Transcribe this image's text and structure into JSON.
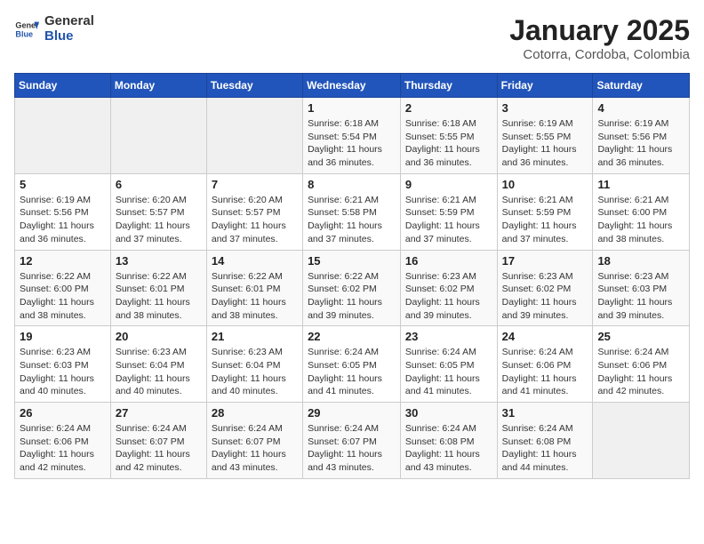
{
  "header": {
    "logo_general": "General",
    "logo_blue": "Blue",
    "title": "January 2025",
    "location": "Cotorra, Cordoba, Colombia"
  },
  "weekdays": [
    "Sunday",
    "Monday",
    "Tuesday",
    "Wednesday",
    "Thursday",
    "Friday",
    "Saturday"
  ],
  "weeks": [
    [
      {
        "day": "",
        "info": ""
      },
      {
        "day": "",
        "info": ""
      },
      {
        "day": "",
        "info": ""
      },
      {
        "day": "1",
        "info": "Sunrise: 6:18 AM\nSunset: 5:54 PM\nDaylight: 11 hours and 36 minutes."
      },
      {
        "day": "2",
        "info": "Sunrise: 6:18 AM\nSunset: 5:55 PM\nDaylight: 11 hours and 36 minutes."
      },
      {
        "day": "3",
        "info": "Sunrise: 6:19 AM\nSunset: 5:55 PM\nDaylight: 11 hours and 36 minutes."
      },
      {
        "day": "4",
        "info": "Sunrise: 6:19 AM\nSunset: 5:56 PM\nDaylight: 11 hours and 36 minutes."
      }
    ],
    [
      {
        "day": "5",
        "info": "Sunrise: 6:19 AM\nSunset: 5:56 PM\nDaylight: 11 hours and 36 minutes."
      },
      {
        "day": "6",
        "info": "Sunrise: 6:20 AM\nSunset: 5:57 PM\nDaylight: 11 hours and 37 minutes."
      },
      {
        "day": "7",
        "info": "Sunrise: 6:20 AM\nSunset: 5:57 PM\nDaylight: 11 hours and 37 minutes."
      },
      {
        "day": "8",
        "info": "Sunrise: 6:21 AM\nSunset: 5:58 PM\nDaylight: 11 hours and 37 minutes."
      },
      {
        "day": "9",
        "info": "Sunrise: 6:21 AM\nSunset: 5:59 PM\nDaylight: 11 hours and 37 minutes."
      },
      {
        "day": "10",
        "info": "Sunrise: 6:21 AM\nSunset: 5:59 PM\nDaylight: 11 hours and 37 minutes."
      },
      {
        "day": "11",
        "info": "Sunrise: 6:21 AM\nSunset: 6:00 PM\nDaylight: 11 hours and 38 minutes."
      }
    ],
    [
      {
        "day": "12",
        "info": "Sunrise: 6:22 AM\nSunset: 6:00 PM\nDaylight: 11 hours and 38 minutes."
      },
      {
        "day": "13",
        "info": "Sunrise: 6:22 AM\nSunset: 6:01 PM\nDaylight: 11 hours and 38 minutes."
      },
      {
        "day": "14",
        "info": "Sunrise: 6:22 AM\nSunset: 6:01 PM\nDaylight: 11 hours and 38 minutes."
      },
      {
        "day": "15",
        "info": "Sunrise: 6:22 AM\nSunset: 6:02 PM\nDaylight: 11 hours and 39 minutes."
      },
      {
        "day": "16",
        "info": "Sunrise: 6:23 AM\nSunset: 6:02 PM\nDaylight: 11 hours and 39 minutes."
      },
      {
        "day": "17",
        "info": "Sunrise: 6:23 AM\nSunset: 6:02 PM\nDaylight: 11 hours and 39 minutes."
      },
      {
        "day": "18",
        "info": "Sunrise: 6:23 AM\nSunset: 6:03 PM\nDaylight: 11 hours and 39 minutes."
      }
    ],
    [
      {
        "day": "19",
        "info": "Sunrise: 6:23 AM\nSunset: 6:03 PM\nDaylight: 11 hours and 40 minutes."
      },
      {
        "day": "20",
        "info": "Sunrise: 6:23 AM\nSunset: 6:04 PM\nDaylight: 11 hours and 40 minutes."
      },
      {
        "day": "21",
        "info": "Sunrise: 6:23 AM\nSunset: 6:04 PM\nDaylight: 11 hours and 40 minutes."
      },
      {
        "day": "22",
        "info": "Sunrise: 6:24 AM\nSunset: 6:05 PM\nDaylight: 11 hours and 41 minutes."
      },
      {
        "day": "23",
        "info": "Sunrise: 6:24 AM\nSunset: 6:05 PM\nDaylight: 11 hours and 41 minutes."
      },
      {
        "day": "24",
        "info": "Sunrise: 6:24 AM\nSunset: 6:06 PM\nDaylight: 11 hours and 41 minutes."
      },
      {
        "day": "25",
        "info": "Sunrise: 6:24 AM\nSunset: 6:06 PM\nDaylight: 11 hours and 42 minutes."
      }
    ],
    [
      {
        "day": "26",
        "info": "Sunrise: 6:24 AM\nSunset: 6:06 PM\nDaylight: 11 hours and 42 minutes."
      },
      {
        "day": "27",
        "info": "Sunrise: 6:24 AM\nSunset: 6:07 PM\nDaylight: 11 hours and 42 minutes."
      },
      {
        "day": "28",
        "info": "Sunrise: 6:24 AM\nSunset: 6:07 PM\nDaylight: 11 hours and 43 minutes."
      },
      {
        "day": "29",
        "info": "Sunrise: 6:24 AM\nSunset: 6:07 PM\nDaylight: 11 hours and 43 minutes."
      },
      {
        "day": "30",
        "info": "Sunrise: 6:24 AM\nSunset: 6:08 PM\nDaylight: 11 hours and 43 minutes."
      },
      {
        "day": "31",
        "info": "Sunrise: 6:24 AM\nSunset: 6:08 PM\nDaylight: 11 hours and 44 minutes."
      },
      {
        "day": "",
        "info": ""
      }
    ]
  ]
}
